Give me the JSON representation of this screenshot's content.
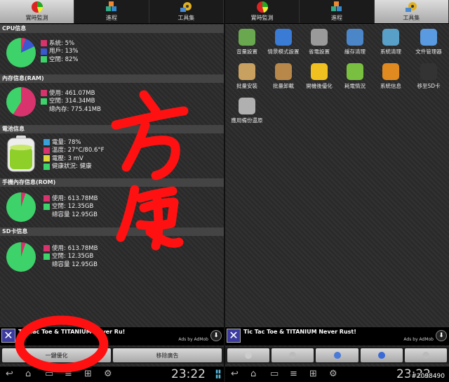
{
  "left": {
    "tabs": [
      {
        "label": "實時監測",
        "active": true
      },
      {
        "label": "進程",
        "active": false
      },
      {
        "label": "工具集",
        "active": false
      }
    ],
    "cpu": {
      "title": "CPU信息",
      "rows": [
        {
          "label": "系統: 5%",
          "color": "#d8336d"
        },
        {
          "label": "用戶: 13%",
          "color": "#3a58d0"
        },
        {
          "label": "空閒: 82%",
          "color": "#3ed26a"
        }
      ]
    },
    "ram": {
      "title": "內存信息(RAM)",
      "rows": [
        {
          "label": "使用: 461.07MB",
          "color": "#d8336d"
        },
        {
          "label": "空閒: 314.34MB",
          "color": "#3ed26a"
        },
        {
          "label": "總內存: 775.41MB",
          "color": ""
        }
      ]
    },
    "battery": {
      "title": "電池信息",
      "rows": [
        {
          "label": "電量: 78%",
          "color": "#3aa0d8"
        },
        {
          "label": "溫度: 27°C/80.6°F",
          "color": "#d8336d"
        },
        {
          "label": "電壓: 3 mV",
          "color": "#e0d83a"
        },
        {
          "label": "健康狀況: 健康",
          "color": "#3ed26a"
        }
      ]
    },
    "rom": {
      "title": "手機內存信息(ROM)",
      "rows": [
        {
          "label": "使用: 613.78MB",
          "color": "#d8336d"
        },
        {
          "label": "空閒: 12.35GB",
          "color": "#3ed26a"
        },
        {
          "label": "總容量 12.95GB",
          "color": ""
        }
      ]
    },
    "sd": {
      "title": "SD卡信息",
      "rows": [
        {
          "label": "使用: 613.78MB",
          "color": "#d8336d"
        },
        {
          "label": "空閒: 12.35GB",
          "color": "#3ed26a"
        },
        {
          "label": "總容量 12.95GB",
          "color": ""
        }
      ]
    },
    "ad": {
      "text": "Tic Tac Toe & TITANIUM Never Ru!",
      "sub": "Ads by AdMob"
    },
    "buttons": [
      "一鍵優化",
      "移除廣告"
    ],
    "clock": "23:22"
  },
  "right": {
    "tabs": [
      {
        "label": "實時監測",
        "active": false
      },
      {
        "label": "進程",
        "active": false
      },
      {
        "label": "工具集",
        "active": true
      }
    ],
    "tools": [
      {
        "label": "音量設置",
        "color": "#6aa84f"
      },
      {
        "label": "情景模式設置",
        "color": "#3a7bd5"
      },
      {
        "label": "省電設置",
        "color": "#9a9a9a"
      },
      {
        "label": "緩存清理",
        "color": "#4a86c8"
      },
      {
        "label": "系統清理",
        "color": "#58a0c8"
      },
      {
        "label": "文件管理器",
        "color": "#5a9ae0"
      },
      {
        "label": "批量安裝",
        "color": "#c8a060"
      },
      {
        "label": "批量卸載",
        "color": "#b8884a"
      },
      {
        "label": "開機後優化",
        "color": "#f0c020"
      },
      {
        "label": "耗電情況",
        "color": "#7ac040"
      },
      {
        "label": "系統信息",
        "color": "#e08a20"
      },
      {
        "label": "移至SD卡",
        "color": "#333333"
      },
      {
        "label": "應用備份還原",
        "color": "#b0b0b0"
      }
    ],
    "ad": {
      "text": "Tic Tac Toe & TITANIUM Never Rust!",
      "sub": "Ads by AdMob"
    },
    "clock": "23:22"
  },
  "watermark": "#2098490",
  "handwriting": "方便"
}
